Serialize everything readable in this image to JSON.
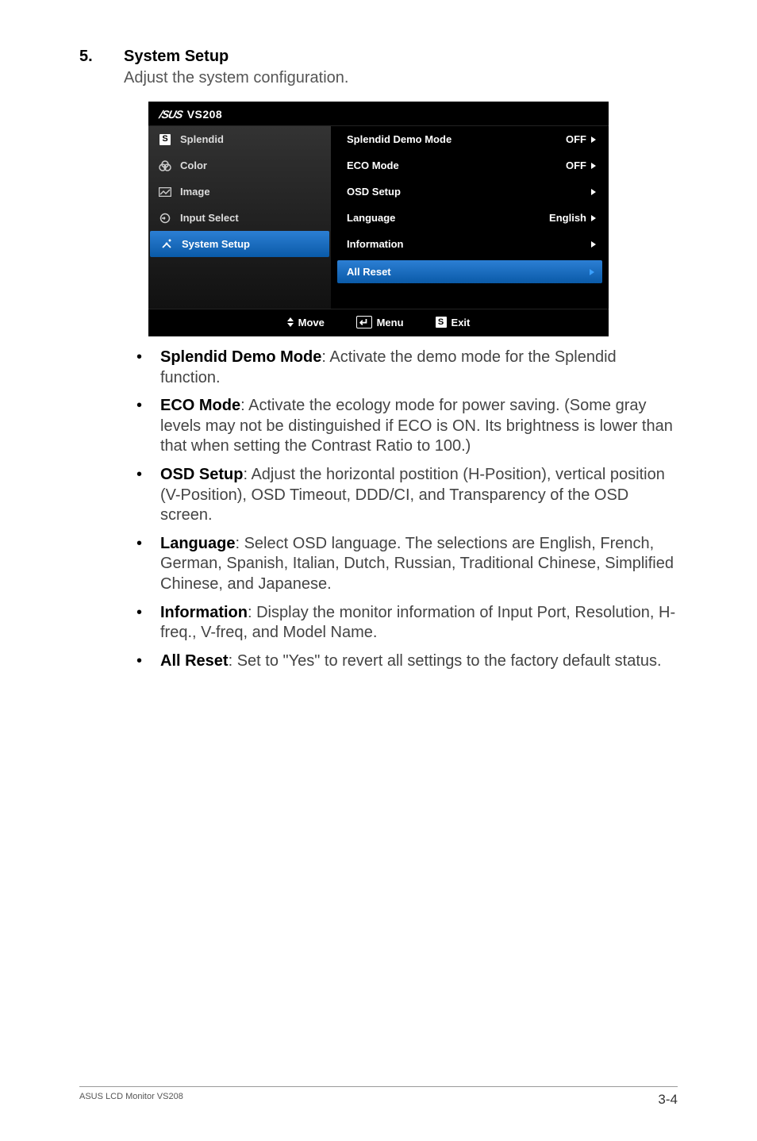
{
  "section": {
    "number": "5.",
    "title": "System Setup",
    "subtitle": "Adjust the system configuration."
  },
  "osd": {
    "brand": "/SUS",
    "model": "VS208",
    "left_items": [
      {
        "label": "Splendid"
      },
      {
        "label": "Color"
      },
      {
        "label": "Image"
      },
      {
        "label": "Input Select"
      },
      {
        "label": "System Setup"
      }
    ],
    "right_rows": [
      {
        "label": "Splendid Demo Mode",
        "value": "OFF"
      },
      {
        "label": "ECO Mode",
        "value": "OFF"
      },
      {
        "label": "OSD Setup",
        "value": ""
      },
      {
        "label": "Language",
        "value": "English"
      },
      {
        "label": "Information",
        "value": ""
      }
    ],
    "highlight_label": "All Reset",
    "footer": {
      "move": "Move",
      "menu": "Menu",
      "exit": "Exit"
    }
  },
  "bullets": {
    "b0": {
      "term": "Splendid Demo Mode",
      "text": ": Activate the demo mode for the Splendid function."
    },
    "b1": {
      "term": "ECO Mode",
      "text": ": Activate the ecology mode for power saving. (Some gray levels may not be distinguished if ECO is ON. Its brightness is lower than that when setting the Contrast Ratio to 100.)"
    },
    "b2": {
      "term": "OSD Setup",
      "text": ": Adjust the horizontal postition (H-Position), vertical position (V-Position), OSD Timeout, DDD/CI, and Transparency of the OSD screen."
    },
    "b3": {
      "term": "Language",
      "text": ": Select OSD language. The selections are English, French, German, Spanish, Italian, Dutch, Russian, Traditional Chinese, Simplified Chinese, and Japanese."
    },
    "b4": {
      "term": "Information",
      "text": ": Display the monitor information of Input Port, Resolution, H-freq., V-freq, and Model Name."
    },
    "b5": {
      "term": "All Reset",
      "text": ": Set to \"Yes\" to revert all settings to the factory default status."
    }
  },
  "footer": {
    "left": "ASUS LCD Monitor VS208",
    "right": "3-4"
  }
}
